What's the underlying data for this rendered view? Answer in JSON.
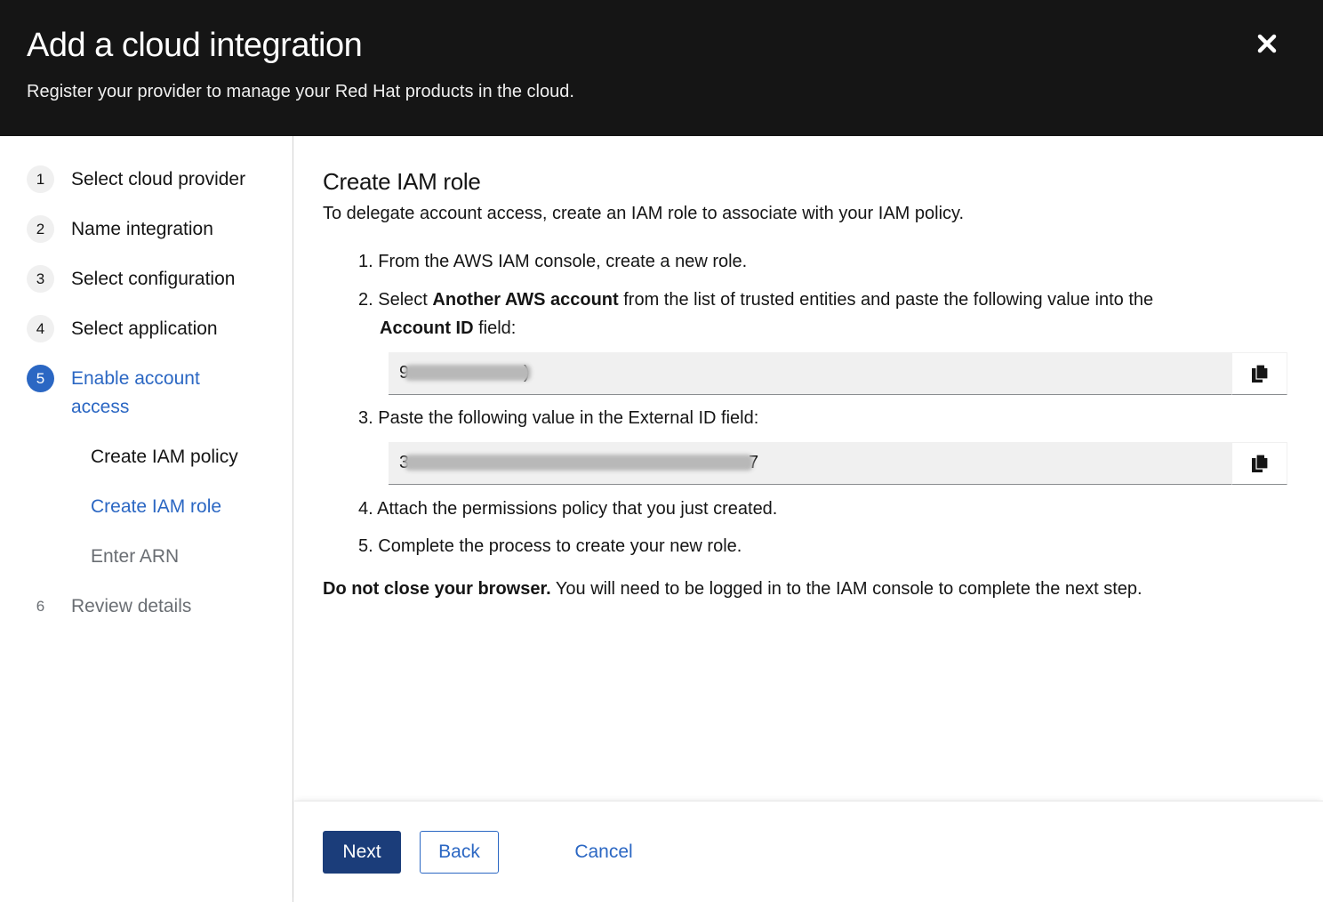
{
  "header": {
    "title": "Add a cloud integration",
    "subtitle": "Register your provider to manage your Red Hat products in the cloud.",
    "close_icon": "close-icon"
  },
  "wizard_nav": {
    "steps": [
      {
        "number": "1",
        "label": "Select cloud provider",
        "state": "visited"
      },
      {
        "number": "2",
        "label": "Name integration",
        "state": "visited"
      },
      {
        "number": "3",
        "label": "Select configuration",
        "state": "visited"
      },
      {
        "number": "4",
        "label": "Select application",
        "state": "visited"
      },
      {
        "number": "5",
        "label": "Enable account access",
        "state": "current"
      },
      {
        "number": "6",
        "label": "Review details",
        "state": "disabled"
      }
    ],
    "substeps": [
      {
        "label": "Create IAM policy",
        "state": "visited"
      },
      {
        "label": "Create IAM role",
        "state": "current"
      },
      {
        "label": "Enter ARN",
        "state": "disabled"
      }
    ]
  },
  "main": {
    "title": "Create IAM role",
    "intro": "To delegate account access, create an IAM role to associate with your IAM policy.",
    "steps": {
      "s1": {
        "num": "1.",
        "text": "From the AWS IAM console, create a new role."
      },
      "s2": {
        "num": "2.",
        "pre": "Select ",
        "bold1": "Another AWS account",
        "mid": " from the list of trusted entities and paste the following value into the",
        "bold2": "Account ID",
        "post": " field:"
      },
      "s3": {
        "num": "3.",
        "text": "Paste the following value in the External ID field:"
      },
      "s4": {
        "num": "4.",
        "text": "Attach the permissions policy that you just created."
      },
      "s5": {
        "num": "5.",
        "text": "Complete the process to create your new role."
      }
    },
    "account_id": {
      "visible_start": "9",
      "visible_end": ")",
      "redacted": true,
      "copy_icon": "copy-icon"
    },
    "external_id": {
      "visible_start": "3",
      "visible_end": "7",
      "redacted": true,
      "copy_icon": "copy-icon"
    },
    "warning_bold": "Do not close your browser.",
    "warning_text": " You will need to be logged in to the IAM console to complete the next step."
  },
  "footer": {
    "next_label": "Next",
    "back_label": "Back",
    "cancel_label": "Cancel"
  },
  "colors": {
    "header_bg": "#151515",
    "accent": "#2b67c3",
    "primary_button": "#1b3d7a"
  }
}
